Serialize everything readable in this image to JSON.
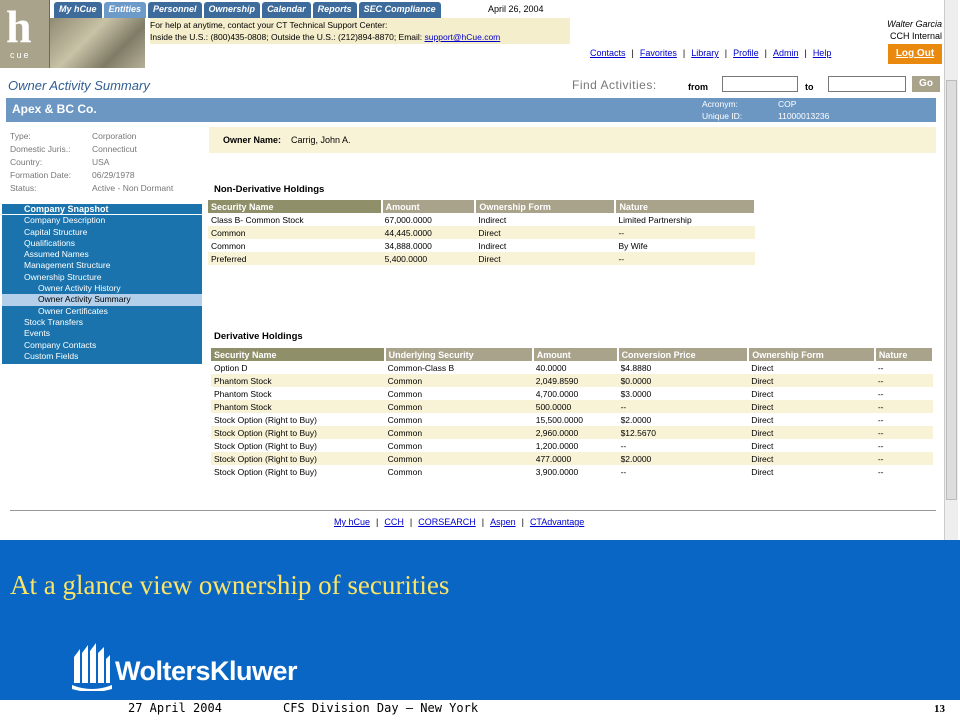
{
  "tabs": [
    "My hCue",
    "Entities",
    "Personnel",
    "Ownership",
    "Calendar",
    "Reports",
    "SEC Compliance"
  ],
  "active_tab": "Entities",
  "date": "April 26, 2004",
  "help": {
    "line1": "For help at anytime, contact your CT Technical Support Center:",
    "line2": "Inside the U.S.: (800)435-0808; Outside the U.S.: (212)894-8870; Email:",
    "email": "support@hCue.com"
  },
  "user": {
    "name": "Walter Garcia",
    "company": "CCH Internal"
  },
  "toplinks": [
    "Contacts",
    "Favorites",
    "Library",
    "Profile",
    "Admin",
    "Help"
  ],
  "logout": "Log Out",
  "page_title": "Owner Activity Summary",
  "find": {
    "label": "Find Activities:",
    "from": "from",
    "to": "to",
    "go": "Go"
  },
  "company": {
    "name": "Apex & BC Co.",
    "acronym_label": "Acronym:",
    "acronym": "COP",
    "uid_label": "Unique ID:",
    "uid": "11000013236"
  },
  "info": [
    {
      "label": "Type:",
      "value": "Corporation"
    },
    {
      "label": "Domestic Juris.:",
      "value": "Connecticut"
    },
    {
      "label": "Country:",
      "value": "USA"
    },
    {
      "label": "Formation Date:",
      "value": "06/29/1978"
    },
    {
      "label": "Status:",
      "value": "Active - Non Dormant"
    }
  ],
  "sidebar": [
    {
      "label": "Company Snapshot",
      "level": 0,
      "head": true
    },
    {
      "label": "Company Description",
      "level": 0
    },
    {
      "label": "Capital Structure",
      "level": 0
    },
    {
      "label": "Qualifications",
      "level": 0
    },
    {
      "label": "Assumed Names",
      "level": 0
    },
    {
      "label": "Management Structure",
      "level": 0
    },
    {
      "label": "Ownership Structure",
      "level": 0
    },
    {
      "label": "Owner Activity History",
      "level": 1
    },
    {
      "label": "Owner Activity Summary",
      "level": 1,
      "selected": true
    },
    {
      "label": "Owner Certificates",
      "level": 1
    },
    {
      "label": "Stock Transfers",
      "level": 0
    },
    {
      "label": "Events",
      "level": 0
    },
    {
      "label": "Company Contacts",
      "level": 0
    },
    {
      "label": "Custom Fields",
      "level": 0
    }
  ],
  "owner": {
    "label": "Owner Name:",
    "value": "Carrig, John A."
  },
  "nonderiv": {
    "title": "Non-Derivative Holdings",
    "headers": [
      "Security Name",
      "Amount",
      "Ownership Form",
      "Nature"
    ],
    "rows": [
      [
        "Class B- Common Stock",
        "67,000.0000",
        "Indirect",
        "Limited Partnership"
      ],
      [
        "Common",
        "44,445.0000",
        "Direct",
        "--"
      ],
      [
        "Common",
        "34,888.0000",
        "Indirect",
        "By Wife"
      ],
      [
        "Preferred",
        "5,400.0000",
        "Direct",
        "--"
      ]
    ]
  },
  "deriv": {
    "title": "Derivative Holdings",
    "headers": [
      "Security Name",
      "Underlying Security",
      "Amount",
      "Conversion Price",
      "Ownership Form",
      "Nature"
    ],
    "rows": [
      [
        "Option D",
        "Common-Class B",
        "40.0000",
        "$4.8880",
        "Direct",
        "--"
      ],
      [
        "Phantom Stock",
        "Common",
        "2,049.8590",
        "$0.0000",
        "Direct",
        "--"
      ],
      [
        "Phantom Stock",
        "Common",
        "4,700.0000",
        "$3.0000",
        "Direct",
        "--"
      ],
      [
        "Phantom Stock",
        "Common",
        "500.0000",
        "--",
        "Direct",
        "--"
      ],
      [
        "Stock Option (Right to Buy)",
        "Common",
        "15,500.0000",
        "$2.0000",
        "Direct",
        "--"
      ],
      [
        "Stock Option (Right to Buy)",
        "Common",
        "2,960.0000",
        "$12.5670",
        "Direct",
        "--"
      ],
      [
        "Stock Option (Right to Buy)",
        "Common",
        "1,200.0000",
        "--",
        "Direct",
        "--"
      ],
      [
        "Stock Option (Right to Buy)",
        "Common",
        "477.0000",
        "$2.0000",
        "Direct",
        "--"
      ],
      [
        "Stock Option (Right to Buy)",
        "Common",
        "3,900.0000",
        "--",
        "Direct",
        "--"
      ]
    ]
  },
  "footlinks": [
    "My hCue",
    "CCH",
    "CORSEARCH",
    "Aspen",
    "CTAdvantage"
  ],
  "slide": {
    "caption": "At a glance view ownership of securities",
    "brand": "WoltersKluwer",
    "footer_date": "27 April 2004",
    "footer_event": "CFS Division Day – New York",
    "page": "13"
  }
}
